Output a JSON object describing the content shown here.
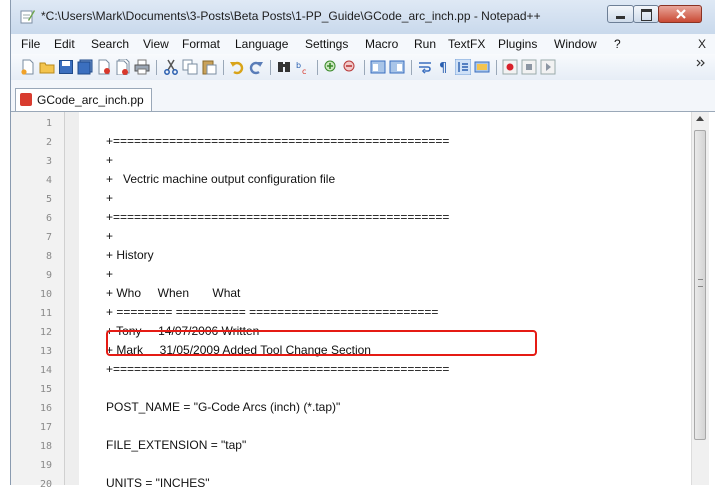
{
  "window": {
    "title": "*C:\\Users\\Mark\\Documents\\3-Posts\\Beta Posts\\1-PP_Guide\\GCode_arc_inch.pp - Notepad++"
  },
  "menubar": {
    "items": [
      "File",
      "Edit",
      "Search",
      "View",
      "Format",
      "Language",
      "Settings",
      "Macro",
      "Run",
      "TextFX",
      "Plugins",
      "Window",
      "?"
    ],
    "close_label": "X"
  },
  "toolbar": {
    "icons": [
      "new-file-icon",
      "open-file-icon",
      "save-icon",
      "save-all-icon",
      "close-icon",
      "close-all-icon",
      "print-icon",
      "cut-icon",
      "copy-icon",
      "paste-icon",
      "undo-icon",
      "redo-icon",
      "find-icon",
      "replace-icon",
      "zoom-in-icon",
      "zoom-out-icon",
      "sync-vertical-icon",
      "sync-horizontal-icon",
      "word-wrap-icon",
      "show-all-characters-icon",
      "indent-guide-icon",
      "user-language-icon",
      "record-macro-icon",
      "stop-macro-icon",
      "playback-macro-icon"
    ]
  },
  "tab": {
    "label": "GCode_arc_inch.pp"
  },
  "editor": {
    "line_numbers": [
      "1",
      "2",
      "3",
      "4",
      "5",
      "6",
      "7",
      "8",
      "9",
      "10",
      "11",
      "12",
      "13",
      "14",
      "15",
      "16",
      "17",
      "18",
      "19",
      "20"
    ],
    "lines": {
      "l2": "+================================================",
      "l3": "+",
      "l4": "+   Vectric machine output configuration file",
      "l5": "+",
      "l6": "+================================================",
      "l7": "+",
      "l8": "+ History",
      "l9": "+",
      "l10": "+ Who     When       What",
      "l11": "+ ======== ========== ===========================",
      "l12": "+ Tony     14/07/2006 Written",
      "l13": "+ Mark     31/05/2009 Added Tool Change Section",
      "l14": "+================================================",
      "l16": "POST_NAME = \"G-Code Arcs (inch) (*.tap)\"",
      "l18": "FILE_EXTENSION = \"tap\"",
      "l20": "UNITS = \"INCHES\""
    },
    "highlight_color": "#e51b14"
  }
}
